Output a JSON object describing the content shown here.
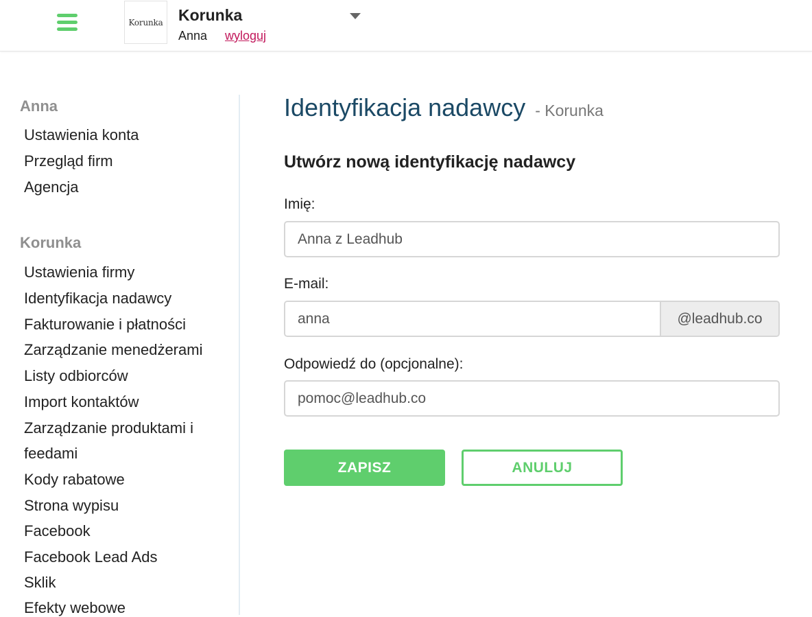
{
  "header": {
    "logo_text": "Korunka",
    "company_name": "Korunka",
    "user_name": "Anna",
    "logout_label": "wyloguj"
  },
  "sidebar": {
    "groups": [
      {
        "title": "Anna",
        "items": [
          "Ustawienia konta",
          "Przegląd firm",
          "Agencja"
        ]
      },
      {
        "title": "Korunka",
        "items": [
          "Ustawienia firmy",
          "Identyfikacja nadawcy",
          "Fakturowanie i płatności",
          "Zarządzanie menedżerami",
          "Listy odbiorców",
          "Import kontaktów",
          "Zarządzanie produktami i",
          "feedami",
          "Kody rabatowe",
          "Strona wypisu",
          "Facebook",
          "Facebook Lead Ads",
          "Sklik",
          "Efekty webowe"
        ]
      }
    ]
  },
  "main": {
    "title": "Identyfikacja nadawcy",
    "subtitle": "- Korunka",
    "section_title": "Utwórz nową identyfikację nadawcy",
    "form": {
      "name_label": "Imię:",
      "name_value": "Anna z Leadhub",
      "email_label": "E-mail:",
      "email_value": "anna",
      "email_domain": "@leadhub.co",
      "reply_label": "Odpowiedź do (opcjonalne):",
      "reply_value": "pomoc@leadhub.co"
    },
    "save_label": "ZAPISZ",
    "cancel_label": "ANULUJ"
  },
  "colors": {
    "accent_green": "#5fce6d",
    "title_blue": "#1b4965",
    "logout_pink": "#c2185b"
  }
}
